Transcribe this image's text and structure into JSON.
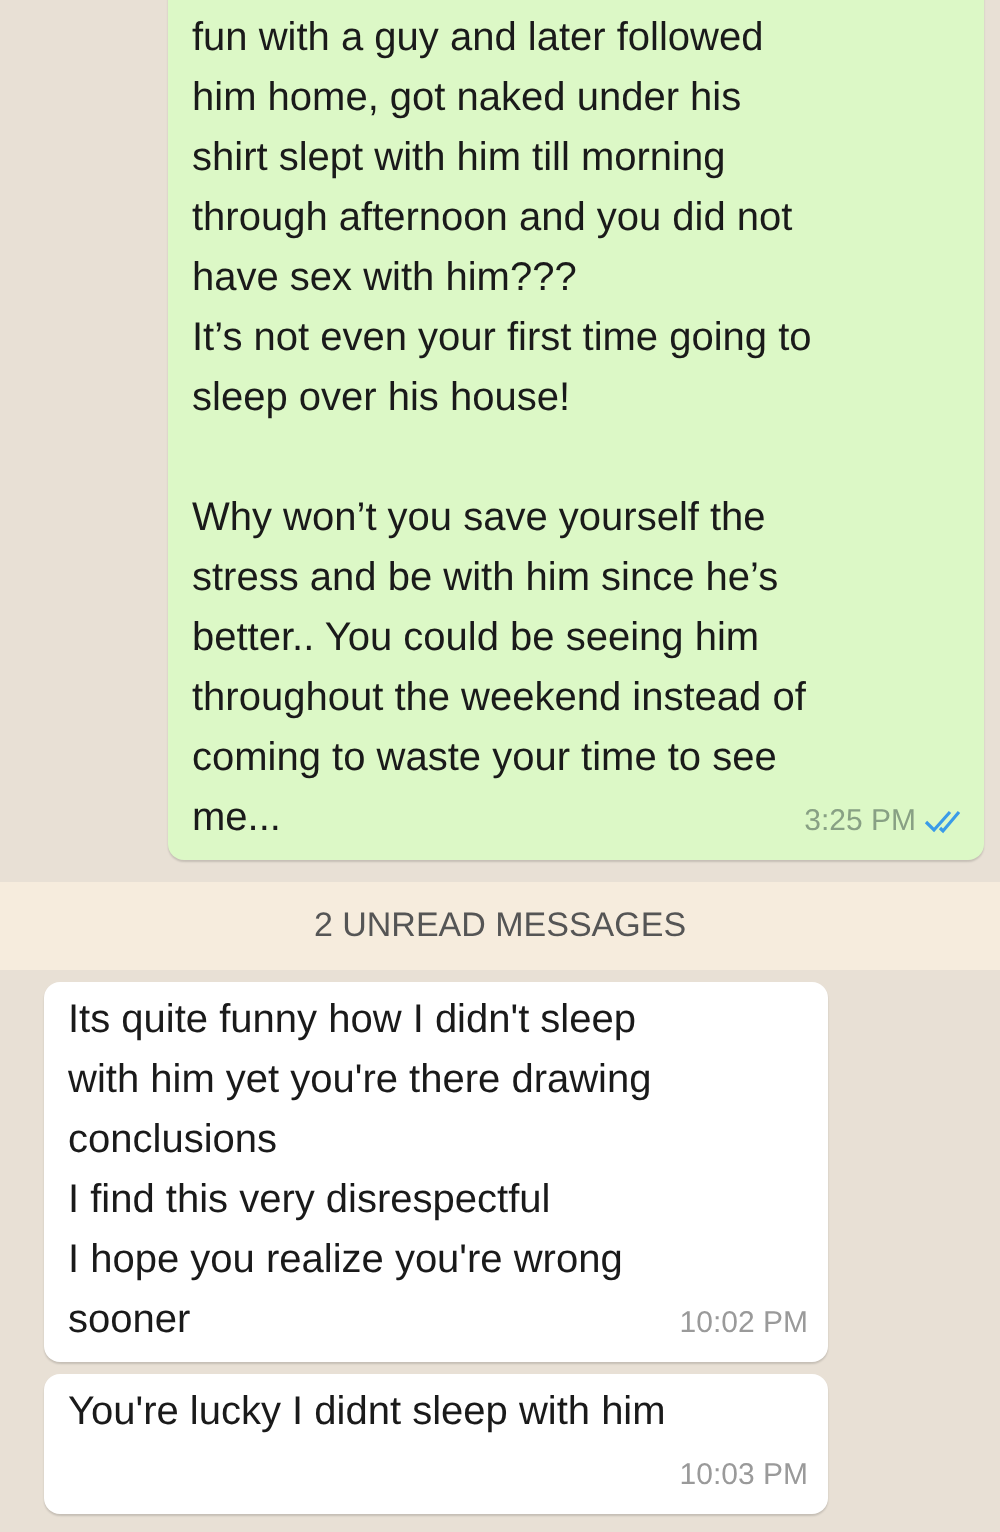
{
  "chat": [
    {
      "kind": "outgoing",
      "paragraphs": [
        [
          "fun with a guy and later followed",
          "him home, got naked under his",
          "shirt slept with him till morning",
          "through afternoon and you did not",
          "have sex with him???",
          "It’s not even your first time going to",
          "sleep over his house!"
        ],
        [
          "Why won’t you save yourself the",
          "stress and be with him since he’s",
          "better.. You could be seeing him",
          "throughout the weekend instead of",
          "coming to waste your time to see",
          "me..."
        ]
      ],
      "time": "3:25 PM",
      "read": true
    },
    {
      "kind": "divider",
      "label": "2 UNREAD MESSAGES"
    },
    {
      "kind": "incoming",
      "paragraphs": [
        [
          "Its quite funny how I didn't sleep",
          "with him yet you're there drawing",
          "conclusions",
          "I find this very disrespectful",
          "I hope you realize you're wrong",
          "sooner"
        ]
      ],
      "time": "10:02 PM"
    },
    {
      "kind": "incoming",
      "paragraphs": [
        [
          "You're lucky I didnt sleep with him"
        ]
      ],
      "time": "10:03 PM"
    }
  ]
}
